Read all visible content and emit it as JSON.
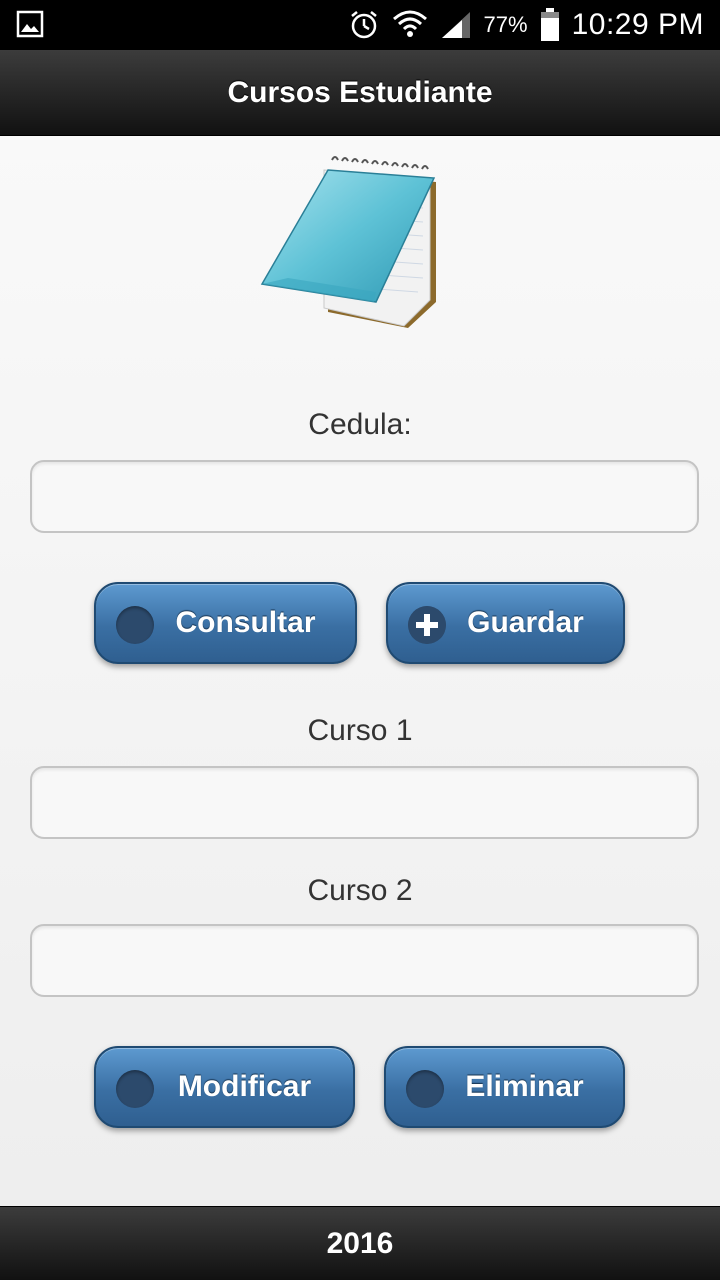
{
  "status_bar": {
    "battery_percent": "77%",
    "time": "10:29 PM",
    "icons": [
      "gallery-icon",
      "alarm-icon",
      "wifi-icon",
      "signal-icon",
      "battery-icon"
    ]
  },
  "header": {
    "title": "Cursos Estudiante"
  },
  "form": {
    "cedula_label": "Cedula:",
    "cedula_value": "",
    "curso1_label": "Curso 1",
    "curso1_value": "",
    "curso2_label": "Curso 2",
    "curso2_value": ""
  },
  "buttons": {
    "consultar": "Consultar",
    "guardar": "Guardar",
    "modificar": "Modificar",
    "eliminar": "Eliminar"
  },
  "footer": {
    "text": "2016"
  },
  "colors": {
    "button_blue": "#3a6fa3",
    "header_dark": "#111111",
    "content_bg": "#f4f4f4"
  }
}
